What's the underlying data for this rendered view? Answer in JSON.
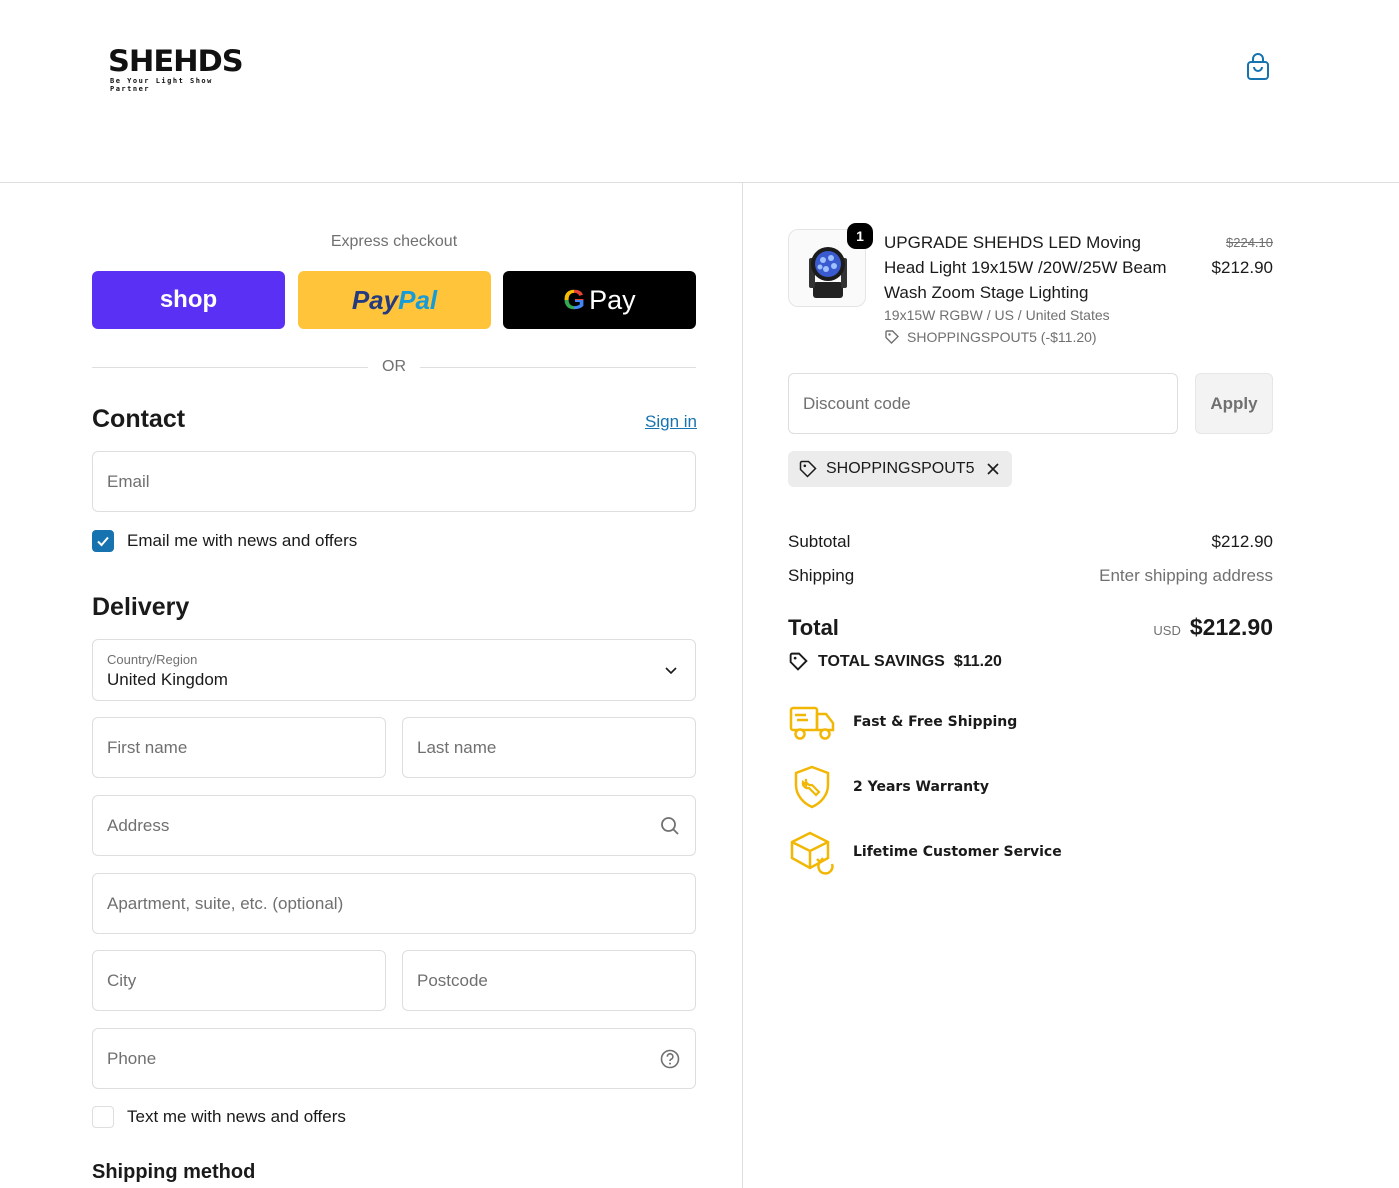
{
  "brand": {
    "logo_text": "SHEHDS",
    "tagline": "Be Your Light Show Partner"
  },
  "express": {
    "title": "Express checkout",
    "shop_label": "shop",
    "paypal_part1": "Pay",
    "paypal_part2": "Pal",
    "gpay_g": "G",
    "gpay_label": "Pay",
    "or_label": "OR"
  },
  "contact": {
    "title": "Contact",
    "signin_label": "Sign in",
    "email_placeholder": "Email",
    "news_label": "Email me with news and offers",
    "news_checked": true
  },
  "delivery": {
    "title": "Delivery",
    "country_label": "Country/Region",
    "country_value": "United Kingdom",
    "first_name_placeholder": "First name",
    "last_name_placeholder": "Last name",
    "address_placeholder": "Address",
    "apartment_placeholder": "Apartment, suite, etc. (optional)",
    "city_placeholder": "City",
    "postcode_placeholder": "Postcode",
    "phone_placeholder": "Phone",
    "sms_label": "Text me with news and offers",
    "sms_checked": false
  },
  "shipping_method": {
    "title": "Shipping method"
  },
  "order": {
    "quantity": "1",
    "product_title": "UPGRADE SHEHDS LED Moving Head Light 19x15W /20W/25W Beam Wash Zoom Stage Lighting",
    "variant": "19x15W RGBW / US / United States",
    "discount_applied": "SHOPPINGSPOUT5 (-$11.20)",
    "price_original": "$224.10",
    "price_final": "$212.90"
  },
  "discount": {
    "placeholder": "Discount code",
    "apply_label": "Apply",
    "chip_code": "SHOPPINGSPOUT5"
  },
  "summary": {
    "subtotal_label": "Subtotal",
    "subtotal_value": "$212.90",
    "shipping_label": "Shipping",
    "shipping_value": "Enter shipping address",
    "total_label": "Total",
    "currency": "USD",
    "total_value": "$212.90",
    "savings_label": "TOTAL SAVINGS",
    "savings_value": "$11.20"
  },
  "features": [
    {
      "label": "Fast & Free Shipping",
      "icon": "truck-icon"
    },
    {
      "label": "2 Years Warranty",
      "icon": "shield-wrench-icon"
    },
    {
      "label": "Lifetime Customer Service",
      "icon": "box-return-icon"
    }
  ],
  "colors": {
    "accent": "#1773b0",
    "shop_pay": "#5a31f4",
    "paypal_yellow": "#ffc439",
    "feature_icon": "#f2b705"
  }
}
